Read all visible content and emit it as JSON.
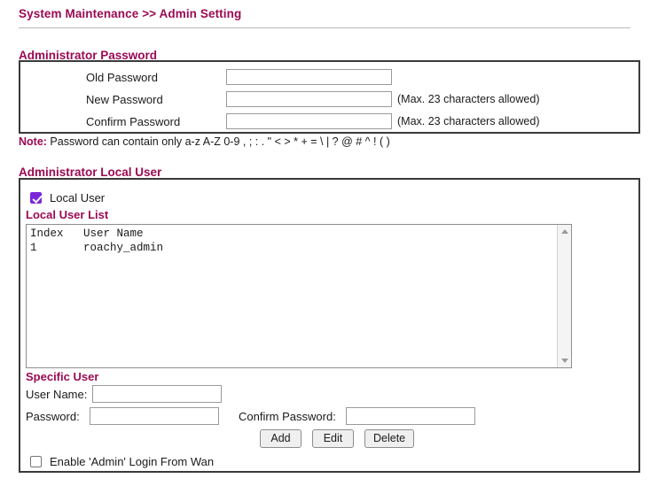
{
  "page": {
    "breadcrumb": "System Maintenance >> Admin Setting"
  },
  "admin_password": {
    "heading": "Administrator Password",
    "rows": [
      {
        "label": "Old Password",
        "value": "",
        "hint": ""
      },
      {
        "label": "New Password",
        "value": "",
        "hint": "(Max. 23 characters allowed)"
      },
      {
        "label": "Confirm Password",
        "value": "",
        "hint": "(Max. 23 characters allowed)"
      }
    ],
    "note_label": "Note:",
    "note_text": " Password can contain only a-z A-Z 0-9 , ; : . \" < > * + = \\ | ? @ # ^ ! ( )"
  },
  "admin_local_user": {
    "heading": "Administrator Local User",
    "local_user_checkbox": {
      "label": "Local User",
      "checked": true
    },
    "list_heading": "Local User List",
    "list_columns": [
      "Index",
      "User Name"
    ],
    "list_text": "Index   User Name\n1       roachy_admin",
    "specific_user": {
      "heading": "Specific User",
      "username_label": "User Name:",
      "username_value": "",
      "password_label": "Password:",
      "password_value": "",
      "confirm_password_label": "Confirm Password:",
      "confirm_password_value": "",
      "buttons": [
        {
          "label": "Add"
        },
        {
          "label": "Edit"
        },
        {
          "label": "Delete"
        }
      ]
    },
    "admin_wan_checkbox": {
      "label": "Enable 'Admin' Login From Wan",
      "checked": false
    }
  },
  "colors": {
    "heading": "#9b0a52",
    "checkbox_accent": "#7a26d9",
    "panel_border": "#3a3a3a"
  }
}
